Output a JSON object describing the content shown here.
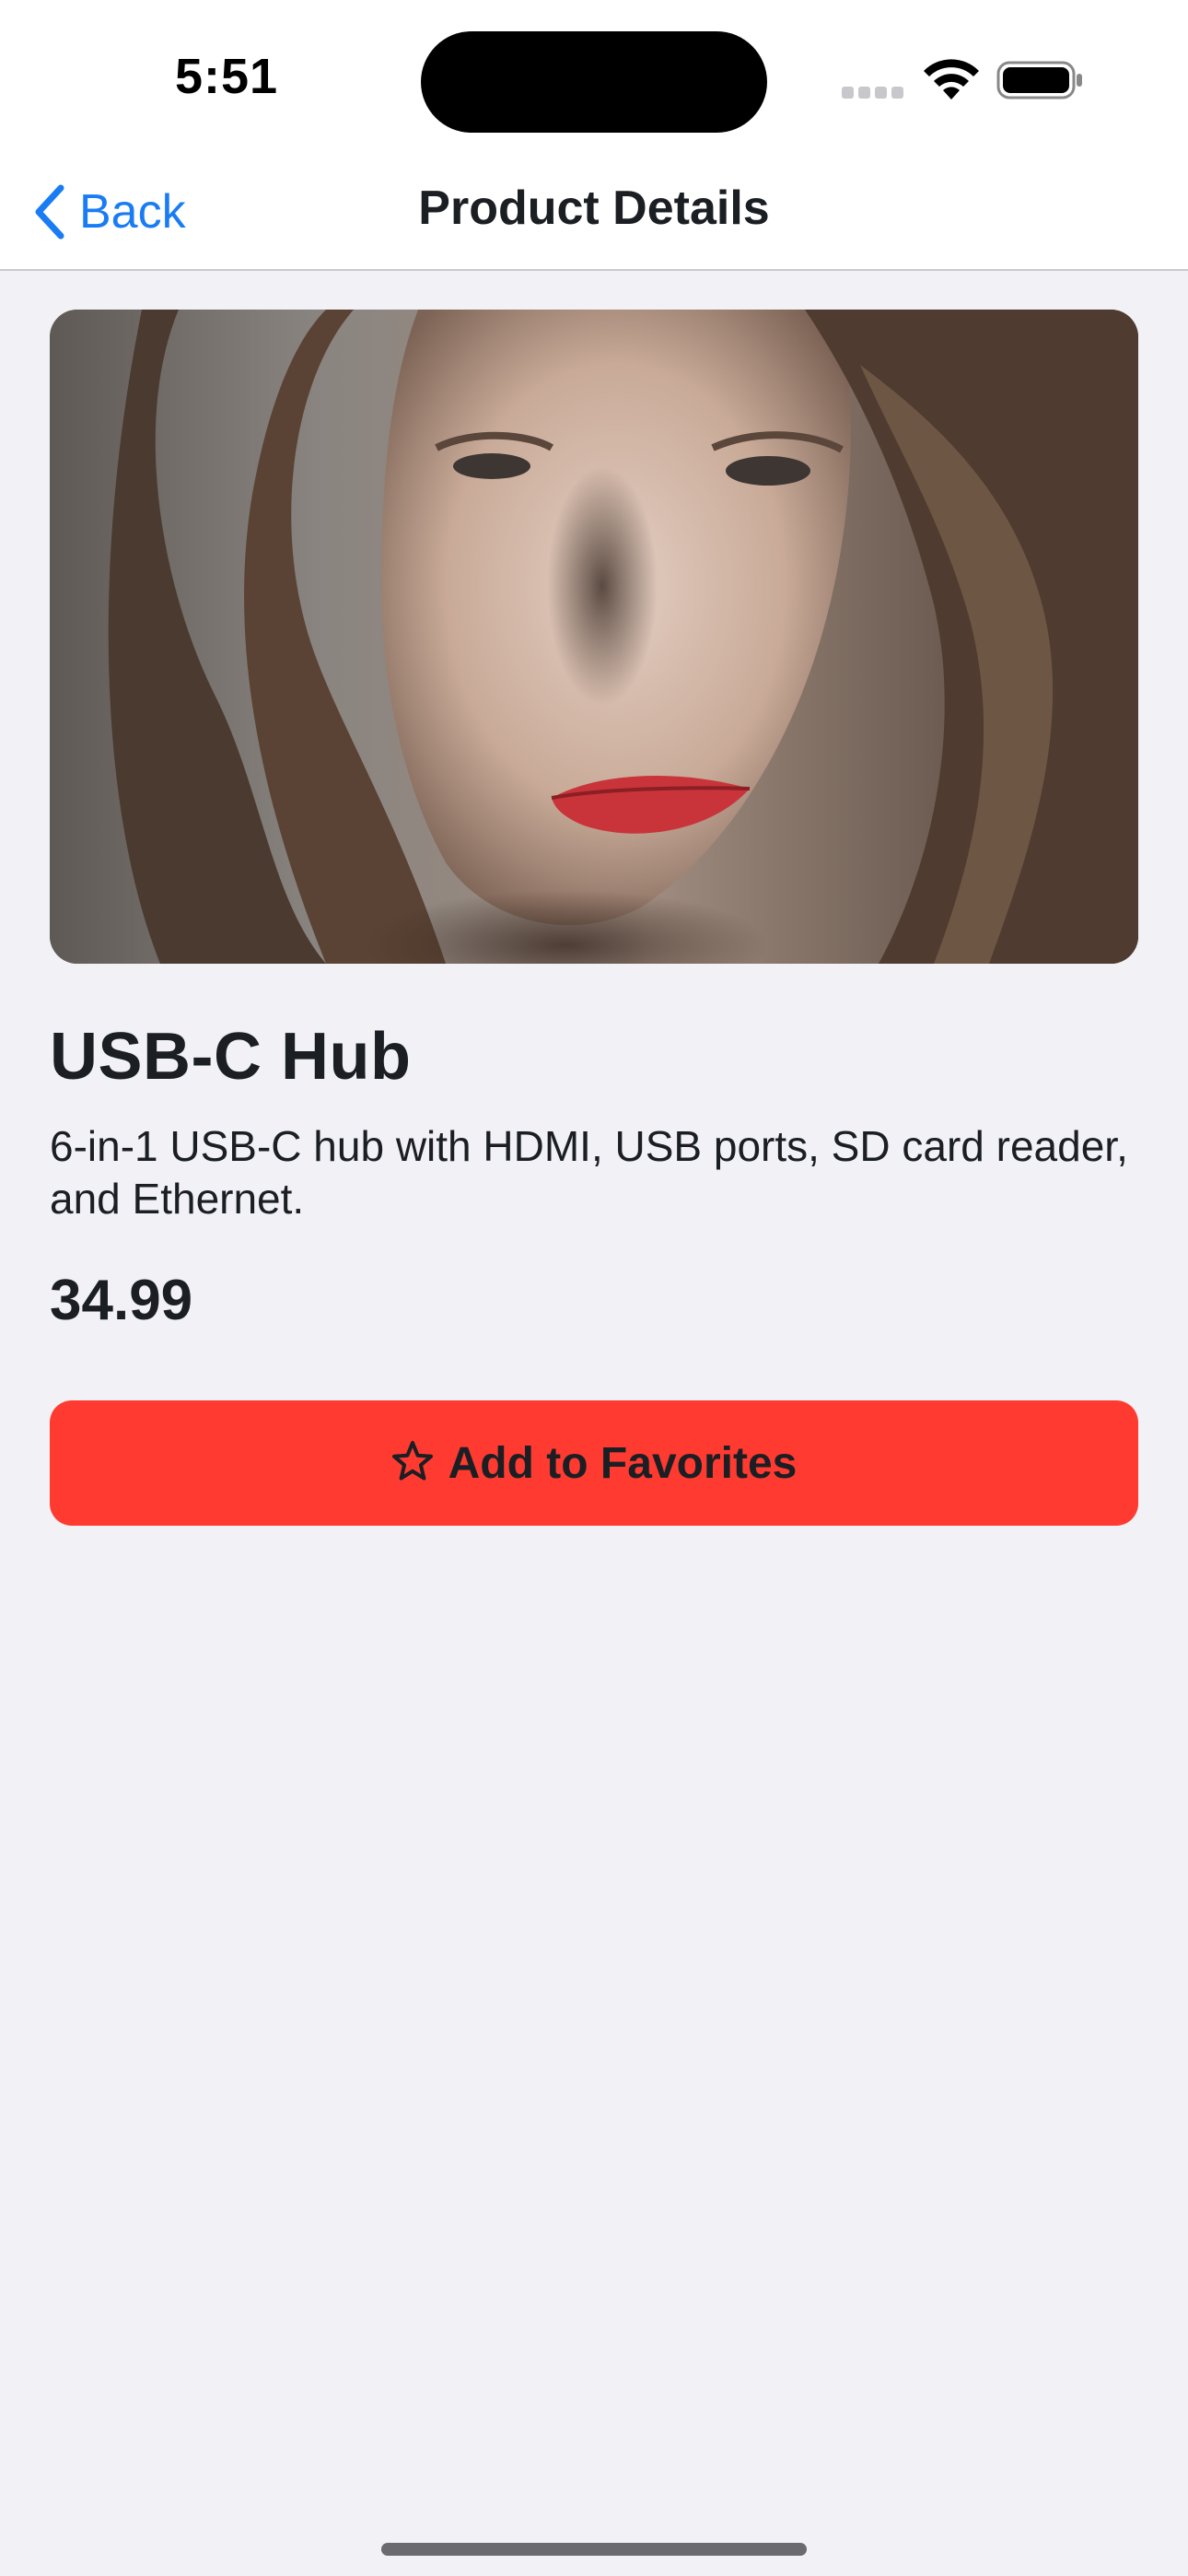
{
  "status_bar": {
    "time": "5:51",
    "icons": [
      "cellular-signal-icon",
      "wifi-icon",
      "battery-icon"
    ]
  },
  "nav": {
    "back_label": "Back",
    "title": "Product Details",
    "back_icon": "chevron-left-icon"
  },
  "product": {
    "image_description_icon": "product-photo",
    "title": "USB-C Hub",
    "description": "6-in-1 USB-C hub with HDMI, USB ports, SD card reader, and Ethernet.",
    "price": "34.99"
  },
  "actions": {
    "favorite_label": "Add to Favorites",
    "favorite_icon": "star-outline-icon"
  },
  "colors": {
    "accent": "#1a7cf4",
    "favorite_button": "#ff3a30",
    "background": "#f1f1f6"
  }
}
